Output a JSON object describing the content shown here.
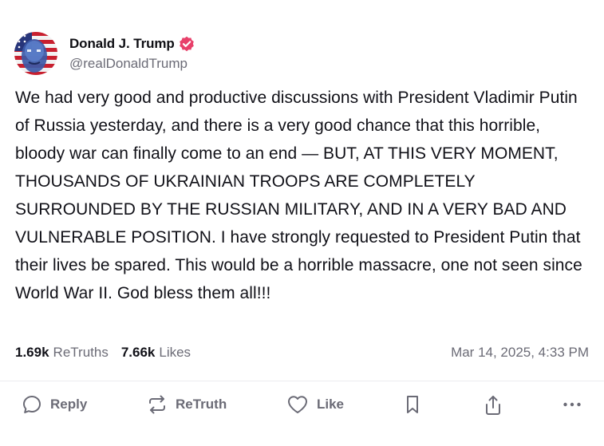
{
  "author": {
    "display_name": "Donald J. Trump",
    "handle": "@realDonaldTrump",
    "verified": true
  },
  "post": {
    "text": "We had very good and productive discussions with President Vladimir Putin of Russia yesterday, and there is a very good chance that this horrible, bloody war can finally come to an end — BUT, AT THIS VERY MOMENT, THOUSANDS OF UKRAINIAN TROOPS ARE COMPLETELY SURROUNDED BY THE RUSSIAN MILITARY, AND IN A VERY BAD AND VULNERABLE POSITION. I have strongly requested to President Putin that their lives be spared. This would be a horrible massacre, one not seen since World War II. God bless them all!!!"
  },
  "stats": {
    "retruths_count": "1.69k",
    "retruths_label": "ReTruths",
    "likes_count": "7.66k",
    "likes_label": "Likes",
    "timestamp": "Mar 14, 2025, 4:33 PM"
  },
  "actions": {
    "reply": "Reply",
    "retruth": "ReTruth",
    "like": "Like"
  },
  "colors": {
    "verified_badge": "#e8406a",
    "muted_text": "#6b6b76",
    "body_text": "#111118"
  },
  "icons": [
    "verified-badge-icon",
    "reply-icon",
    "retruth-icon",
    "like-icon",
    "bookmark-icon",
    "share-icon",
    "more-icon"
  ]
}
